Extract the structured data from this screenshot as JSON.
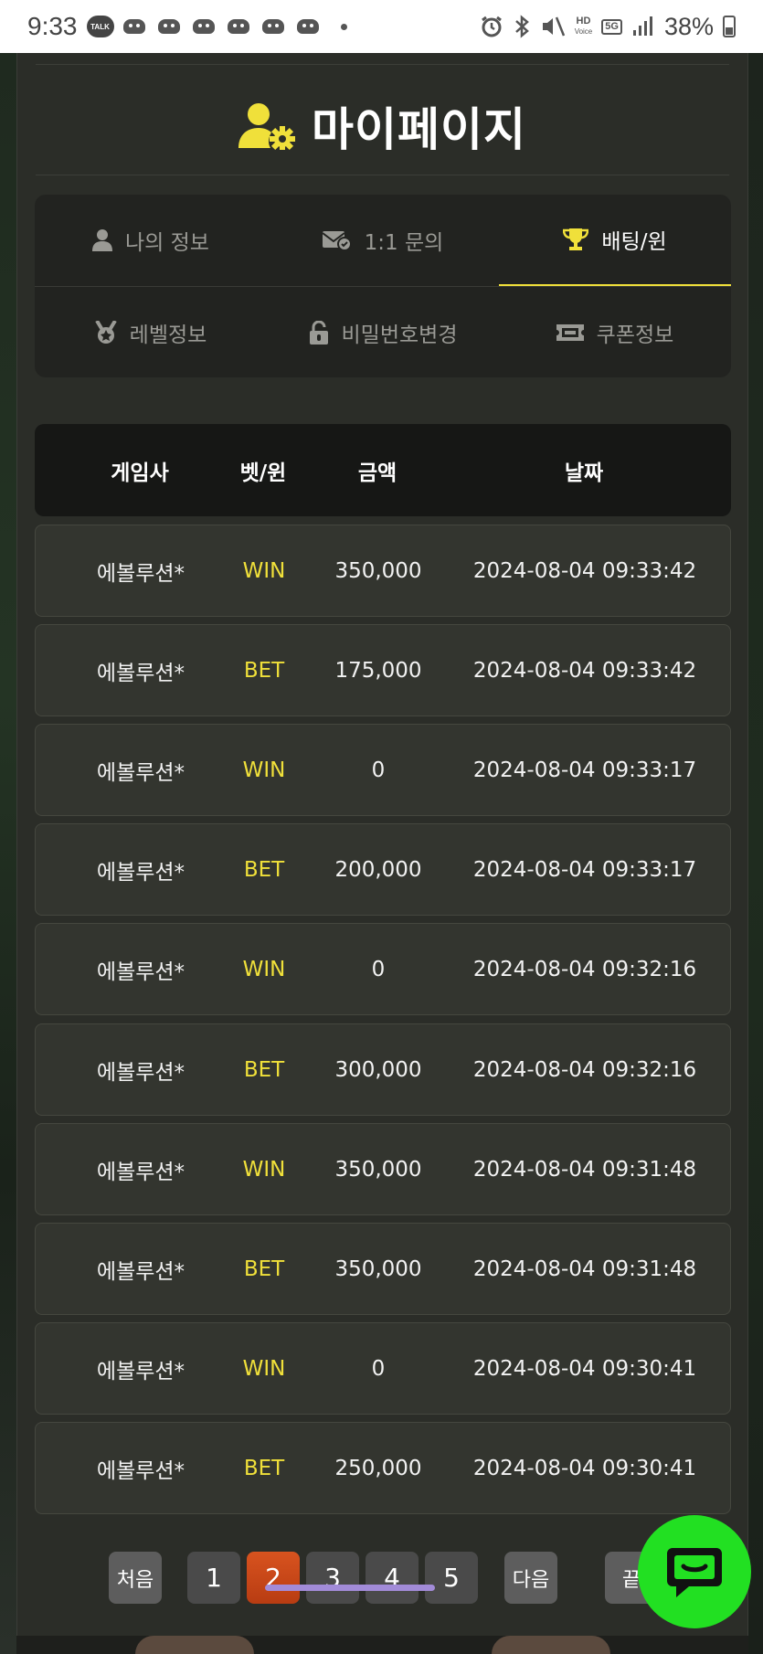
{
  "status_bar": {
    "time": "9:33",
    "talk_badge": "TALK",
    "hd_line1": "HD",
    "hd_line2": "Voice",
    "network": "5G",
    "battery": "38%"
  },
  "page": {
    "title": "마이페이지",
    "accent_color": "#f0e03a"
  },
  "tabs": [
    {
      "label": "나의 정보",
      "icon": "user-icon",
      "active": false
    },
    {
      "label": "1:1 문의",
      "icon": "envelope-check-icon",
      "active": false
    },
    {
      "label": "배팅/윈",
      "icon": "trophy-icon",
      "active": true
    },
    {
      "label": "레벨정보",
      "icon": "medal-icon",
      "active": false
    },
    {
      "label": "비밀번호변경",
      "icon": "unlock-icon",
      "active": false
    },
    {
      "label": "쿠폰정보",
      "icon": "ticket-icon",
      "active": false
    }
  ],
  "table": {
    "headers": [
      "게임사",
      "벳/윈",
      "금액",
      "날짜"
    ],
    "rows": [
      {
        "provider": "에볼루션*",
        "type": "WIN",
        "amount": "350,000",
        "date": "2024-08-04 09:33:42"
      },
      {
        "provider": "에볼루션*",
        "type": "BET",
        "amount": "175,000",
        "date": "2024-08-04 09:33:42"
      },
      {
        "provider": "에볼루션*",
        "type": "WIN",
        "amount": "0",
        "date": "2024-08-04 09:33:17"
      },
      {
        "provider": "에볼루션*",
        "type": "BET",
        "amount": "200,000",
        "date": "2024-08-04 09:33:17"
      },
      {
        "provider": "에볼루션*",
        "type": "WIN",
        "amount": "0",
        "date": "2024-08-04 09:32:16"
      },
      {
        "provider": "에볼루션*",
        "type": "BET",
        "amount": "300,000",
        "date": "2024-08-04 09:32:16"
      },
      {
        "provider": "에볼루션*",
        "type": "WIN",
        "amount": "350,000",
        "date": "2024-08-04 09:31:48"
      },
      {
        "provider": "에볼루션*",
        "type": "BET",
        "amount": "350,000",
        "date": "2024-08-04 09:31:48"
      },
      {
        "provider": "에볼루션*",
        "type": "WIN",
        "amount": "0",
        "date": "2024-08-04 09:30:41"
      },
      {
        "provider": "에볼루션*",
        "type": "BET",
        "amount": "250,000",
        "date": "2024-08-04 09:30:41"
      }
    ]
  },
  "pagination": {
    "first": "처음",
    "pages": [
      "1",
      "2",
      "3",
      "4",
      "5"
    ],
    "current": "2",
    "next": "다음",
    "last": "끝"
  }
}
